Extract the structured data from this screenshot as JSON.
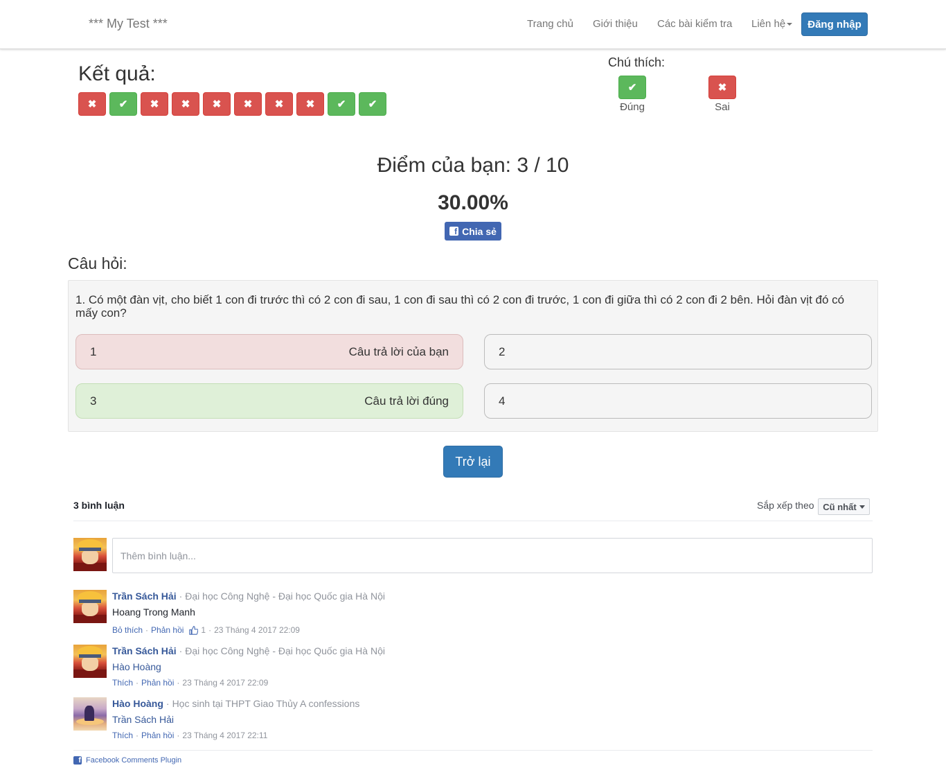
{
  "navbar": {
    "brand": "*** My Test ***",
    "links": [
      "Trang chủ",
      "Giới thiệu",
      "Các bài kiểm tra",
      "Liên hệ"
    ],
    "login": "Đăng nhập"
  },
  "result": {
    "title": "Kết quả:",
    "answers": [
      "wrong",
      "right",
      "wrong",
      "wrong",
      "wrong",
      "wrong",
      "wrong",
      "wrong",
      "right",
      "right"
    ]
  },
  "legend": {
    "title": "Chú thích:",
    "correct_label": "Đúng",
    "wrong_label": "Sai"
  },
  "score": {
    "text": "Điểm của bạn: 3 / 10",
    "percent": "30.00%",
    "share": "Chia sẻ"
  },
  "question": {
    "section_title": "Câu hỏi:",
    "text": "1. Có một đàn vịt, cho biết 1 con đi trước thì có 2 con đi sau, 1 con đi sau thì có 2 con đi trước, 1 con đi giữa thì có 2 con đi 2 bên. Hỏi đàn vịt đó có mấy con?",
    "options": [
      {
        "value": "1",
        "tag": "Câu trả lời của bạn",
        "state": "user-wrong"
      },
      {
        "value": "2",
        "tag": "",
        "state": "none"
      },
      {
        "value": "3",
        "tag": "Câu trả lời đúng",
        "state": "correct"
      },
      {
        "value": "4",
        "tag": "",
        "state": "none"
      }
    ]
  },
  "back_button": "Trở lại",
  "comments": {
    "count": "3 bình luận",
    "sort_label": "Sắp xếp theo",
    "sort_value": "Cũ nhất",
    "input_placeholder": "Thêm bình luận...",
    "items": [
      {
        "author": "Trần Sách Hải",
        "affiliation": "Đại học Công Nghệ - Đại học Quốc gia Hà Nội",
        "body": "Hoang Trong Manh",
        "body_is_link": false,
        "like_action": "Bỏ thích",
        "reply": "Phản hồi",
        "likes": "1",
        "time": "23 Tháng 4 2017 22:09"
      },
      {
        "author": "Trần Sách Hải",
        "affiliation": "Đại học Công Nghệ - Đại học Quốc gia Hà Nội",
        "body": "Hào Hoàng",
        "body_is_link": true,
        "like_action": "Thích",
        "reply": "Phản hồi",
        "likes": "",
        "time": "23 Tháng 4 2017 22:09"
      },
      {
        "author": "Hào Hoàng",
        "affiliation": "Học sinh tại THPT Giao Thủy A confessions",
        "body": "Trần Sách Hải",
        "body_is_link": true,
        "like_action": "Thích",
        "reply": "Phản hồi",
        "likes": "",
        "time": "23 Tháng 4 2017 22:11"
      }
    ],
    "plugin": "Facebook Comments Plugin"
  },
  "colors": {
    "primary": "#337ab7",
    "success": "#5cb85c",
    "danger": "#d9534f",
    "facebook": "#4267b2"
  }
}
